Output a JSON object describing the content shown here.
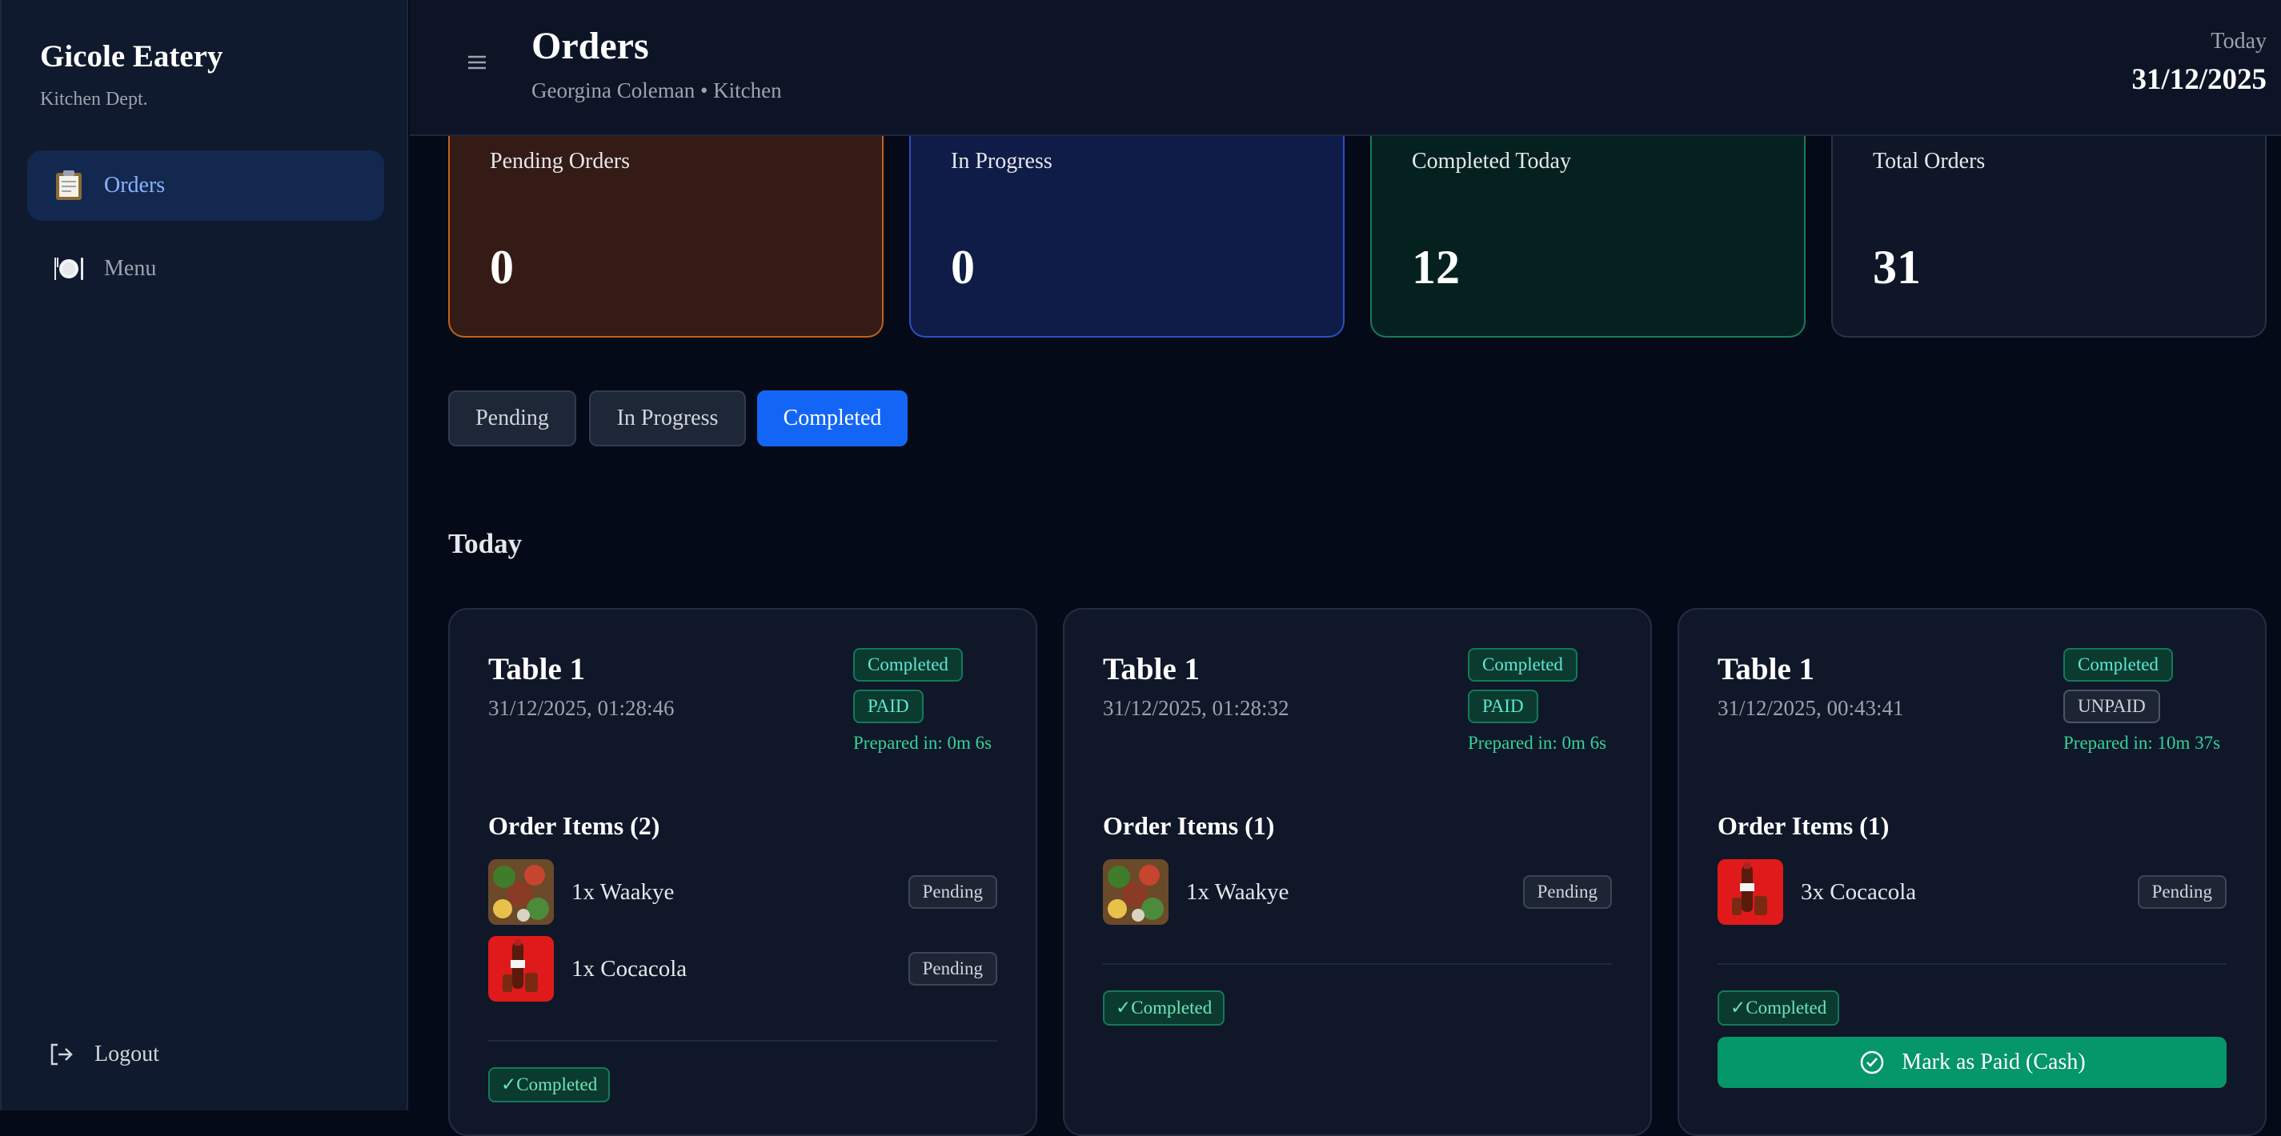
{
  "sidebar": {
    "brand": "Gicole Eatery",
    "dept": "Kitchen Dept.",
    "items": [
      {
        "label": "Orders",
        "icon": "clipboard-icon",
        "active": true
      },
      {
        "label": "Menu",
        "icon": "plate-cutlery-icon",
        "active": false
      }
    ],
    "logout": "Logout"
  },
  "header": {
    "title": "Orders",
    "subtitle": "Georgina Coleman • Kitchen",
    "today_label": "Today",
    "today_date": "31/12/2025"
  },
  "stats": [
    {
      "label": "Pending Orders",
      "value": "0"
    },
    {
      "label": "In Progress",
      "value": "0"
    },
    {
      "label": "Completed Today",
      "value": "12"
    },
    {
      "label": "Total Orders",
      "value": "31"
    }
  ],
  "filters": [
    "Pending",
    "In Progress",
    "Completed"
  ],
  "active_filter": "Completed",
  "section_title": "Today",
  "orders": [
    {
      "table": "Table 1",
      "time": "31/12/2025, 01:28:46",
      "status": "Completed",
      "payment": "PAID",
      "prep": "Prepared in: 0m 6s",
      "items_title": "Order Items (2)",
      "items": [
        {
          "name": "1x Waakye",
          "status": "Pending",
          "thumb": "waakye"
        },
        {
          "name": "1x Cocacola",
          "status": "Pending",
          "thumb": "cocacola"
        }
      ],
      "done_label": "✓Completed"
    },
    {
      "table": "Table 1",
      "time": "31/12/2025, 01:28:32",
      "status": "Completed",
      "payment": "PAID",
      "prep": "Prepared in: 0m 6s",
      "items_title": "Order Items (1)",
      "items": [
        {
          "name": "1x Waakye",
          "status": "Pending",
          "thumb": "waakye"
        }
      ],
      "done_label": "✓Completed"
    },
    {
      "table": "Table 1",
      "time": "31/12/2025, 00:43:41",
      "status": "Completed",
      "payment": "UNPAID",
      "prep": "Prepared in: 10m 37s",
      "items_title": "Order Items (1)",
      "items": [
        {
          "name": "3x Cocacola",
          "status": "Pending",
          "thumb": "cocacola"
        }
      ],
      "done_label": "✓Completed",
      "pay_button": "Mark as Paid (Cash)"
    }
  ],
  "colors": {
    "accent": "#1366f5",
    "success": "#059669",
    "pending_card": "#351b16",
    "progress_card": "#0f1c48",
    "completed_card": "#05211f"
  }
}
